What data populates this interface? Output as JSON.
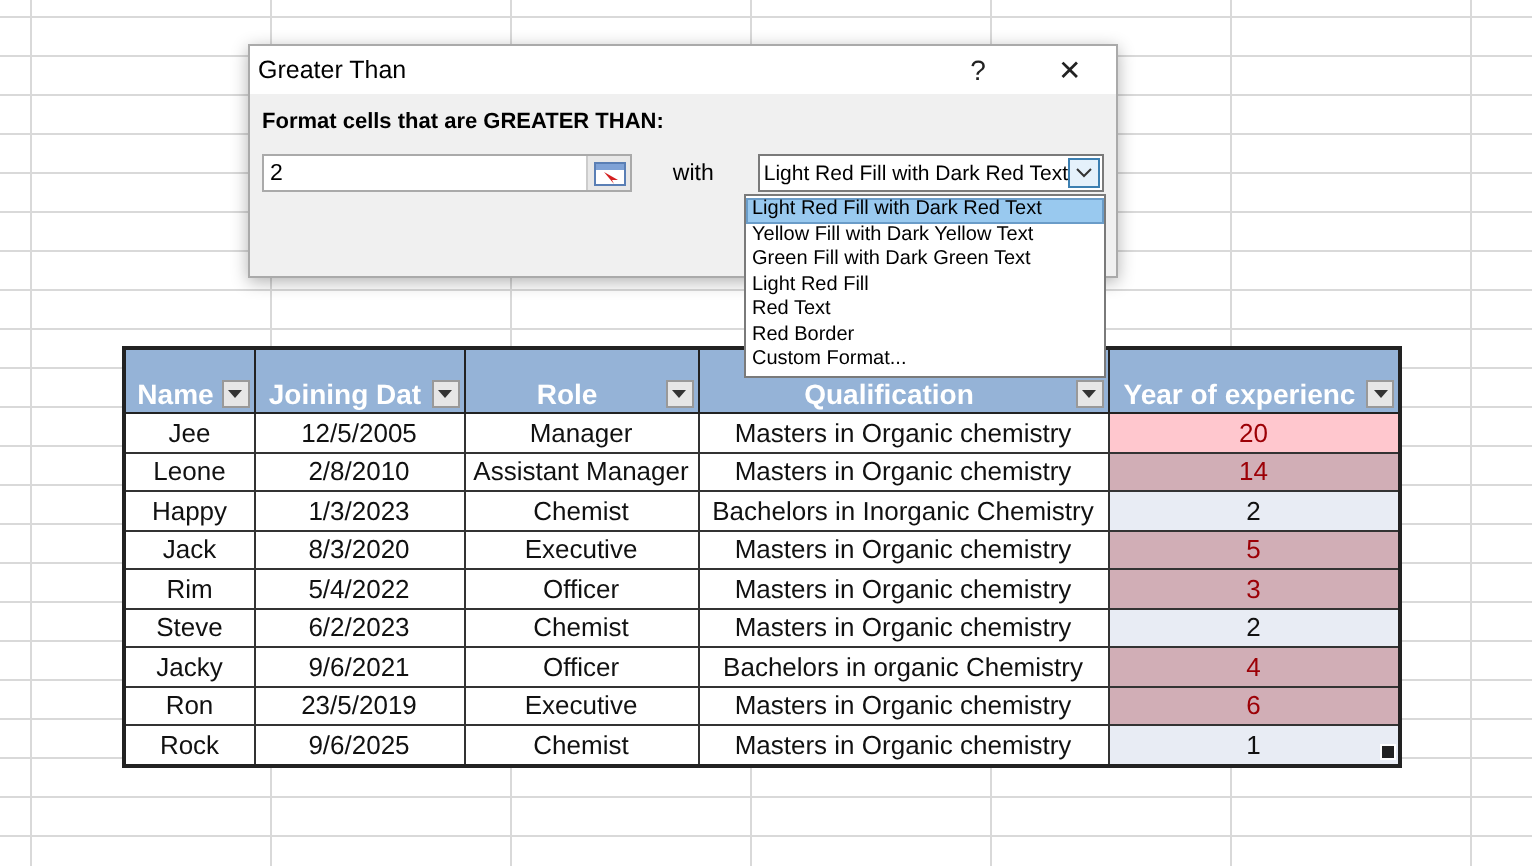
{
  "dialog": {
    "title": "Greater Than",
    "help": "?",
    "close": "✕",
    "prompt": "Format cells that are GREATER THAN:",
    "value": "2",
    "with_label": "with",
    "format": "Light Red Fill with Dark Red Text",
    "options": [
      {
        "label": "Light Red Fill with Dark Red Text",
        "selected": true
      },
      {
        "label": "Yellow Fill with Dark Yellow Text",
        "selected": false
      },
      {
        "label": "Green Fill with Dark Green Text",
        "selected": false
      },
      {
        "label": "Light Red Fill",
        "selected": false
      },
      {
        "label": "Red Text",
        "selected": false
      },
      {
        "label": "Red Border",
        "selected": false
      },
      {
        "label": "Custom Format...",
        "selected": false
      }
    ]
  },
  "table": {
    "columns": [
      "Name",
      "Joining Dat",
      "Role",
      "Qualification",
      "Year of experienc"
    ],
    "rows": [
      {
        "cells": [
          "Jee",
          "12/5/2005",
          "Manager",
          "Masters in Organic chemistry",
          "20"
        ],
        "highlighted": true,
        "active": true
      },
      {
        "cells": [
          "Leone",
          "2/8/2010",
          "Assistant Manager",
          "Masters in Organic chemistry",
          "14"
        ],
        "highlighted": true,
        "active": false
      },
      {
        "cells": [
          "Happy",
          "1/3/2023",
          "Chemist",
          "Bachelors in Inorganic Chemistry",
          "2"
        ],
        "highlighted": false,
        "active": false
      },
      {
        "cells": [
          "Jack",
          "8/3/2020",
          "Executive",
          "Masters in Organic chemistry",
          "5"
        ],
        "highlighted": true,
        "active": false
      },
      {
        "cells": [
          "Rim",
          "5/4/2022",
          "Officer",
          "Masters in Organic chemistry",
          "3"
        ],
        "highlighted": true,
        "active": false
      },
      {
        "cells": [
          "Steve",
          "6/2/2023",
          "Chemist",
          "Masters in Organic chemistry",
          "2"
        ],
        "highlighted": false,
        "active": false
      },
      {
        "cells": [
          "Jacky",
          "9/6/2021",
          "Officer",
          "Bachelors in organic Chemistry",
          "4"
        ],
        "highlighted": true,
        "active": false
      },
      {
        "cells": [
          "Ron",
          "23/5/2019",
          "Executive",
          "Masters in Organic chemistry",
          "6"
        ],
        "highlighted": true,
        "active": false
      },
      {
        "cells": [
          "Rock",
          "9/6/2025",
          "Chemist",
          "Masters in Organic chemistry",
          "1"
        ],
        "highlighted": false,
        "active": false
      }
    ]
  }
}
